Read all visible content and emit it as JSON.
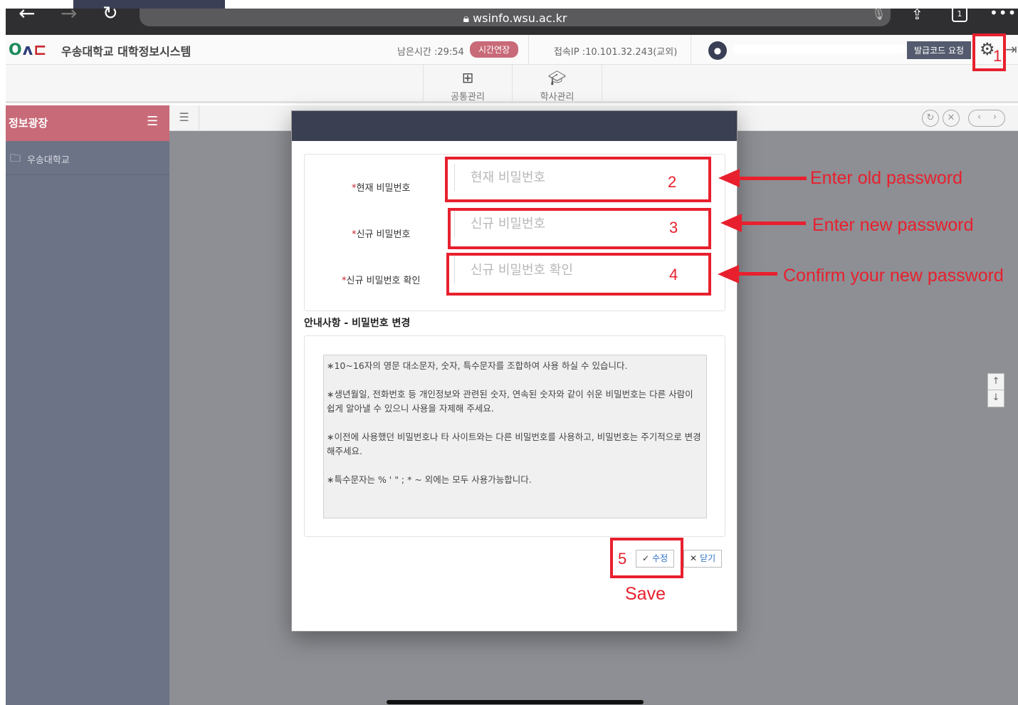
{
  "browser": {
    "url": "wsinfo.wsu.ac.kr",
    "tabs_count": "1",
    "icons": [
      "back-arrow-icon",
      "forward-arrow-icon",
      "reload-icon",
      "lock-icon",
      "mic-icon",
      "share-icon",
      "tabs-icon",
      "more-icon"
    ]
  },
  "header": {
    "logo": {
      "o": "O",
      "a": "ʌ",
      "c": "⊏"
    },
    "title": "우송대학교 대학정보시스템",
    "remaining_time": "남은시간 :29:54",
    "extend_label": "시간연장",
    "ip": "접속IP :10.101.32.243(교외)",
    "issue_code_label": "발급코드 요청"
  },
  "menu": [
    {
      "label": "공통관리",
      "icon": "grid-icon"
    },
    {
      "label": "학사관리",
      "icon": "graduation-cap-icon"
    }
  ],
  "sidebar": {
    "title": "정보광장",
    "items": [
      {
        "label": "우송대학교",
        "icon": "folder-icon"
      }
    ]
  },
  "modal": {
    "fields": [
      {
        "label": "현재 비밀번호",
        "placeholder": "현재 비밀번호",
        "required_mark": "*"
      },
      {
        "label": "신규 비밀번호",
        "placeholder": "신규 비밀번호",
        "required_mark": "*"
      },
      {
        "label": "신규 비밀번호 확인",
        "placeholder": "신규 비밀번호 확인",
        "required_mark": "*"
      }
    ],
    "notice_title": "안내사항 - 비밀번호 변경",
    "notice": [
      "∗10~16자의 영문 대소문자, 숫자, 특수문자를 조합하여 사용 하실 수 있습니다.",
      "∗생년월일, 전화번호 등 개인정보와 관련된 숫자, 연속된 숫자와 같이 쉬운 비밀번호는 다른 사람이 쉽게 알아낼 수 있으니 사용을 자제해 주세요.",
      "∗이전에 사용했던 비밀번호나 타 사이트와는 다른 비밀번호를 사용하고, 비밀번호는 주기적으로 변경해주세요.",
      "∗특수문자는 % ' \" ; * ~ 외에는 모두 사용가능합니다."
    ],
    "save_label": "수정",
    "close_label": "닫기"
  },
  "annotations": {
    "numbers": [
      "1",
      "2",
      "3",
      "4",
      "5"
    ],
    "old_pw": "Enter old password",
    "new_pw": "Enter new password",
    "confirm_pw": "Confirm your new password",
    "save": "Save"
  },
  "colors": {
    "accent": "#c86a78",
    "sidebar": "#6c7387",
    "annotation": "#e8202e",
    "modal_header": "#3a3f51"
  }
}
